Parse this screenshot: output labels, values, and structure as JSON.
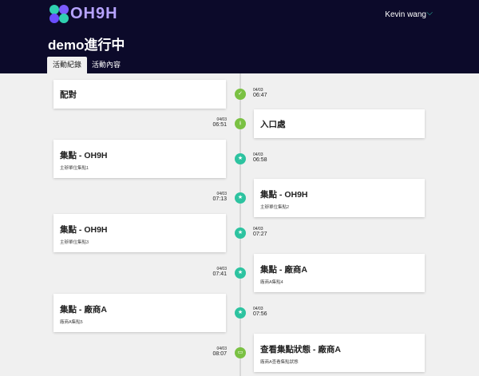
{
  "app": {
    "brand": "OH9H",
    "colors": {
      "header_bg": "#0c0a2a",
      "accent_green": "#7ac143",
      "accent_teal": "#2dc3a0",
      "brand_purple": "#b6a3ff"
    }
  },
  "header": {
    "user_name": "Kevin wang",
    "page_title": "demo進行中",
    "tabs": [
      {
        "label": "活動紀錄",
        "active": true
      },
      {
        "label": "活動內容",
        "active": false
      }
    ]
  },
  "timeline": [
    {
      "side": "left",
      "title": "配對",
      "subtitle": "",
      "date": "04/03",
      "time": "06:47",
      "icon": "check-icon",
      "color": "#7ac143"
    },
    {
      "side": "right",
      "title": "入口處",
      "subtitle": "",
      "date": "04/03",
      "time": "06:51",
      "icon": "download-icon",
      "color": "#7ac143"
    },
    {
      "side": "left",
      "title": "集點 - OH9H",
      "subtitle": "主辦單位集點1",
      "date": "04/03",
      "time": "06:58",
      "icon": "star-icon",
      "color": "#2dc3a0"
    },
    {
      "side": "right",
      "title": "集點 - OH9H",
      "subtitle": "主辦單位集點2",
      "date": "04/03",
      "time": "07:13",
      "icon": "star-icon",
      "color": "#2dc3a0"
    },
    {
      "side": "left",
      "title": "集點 - OH9H",
      "subtitle": "主辦單位集點3",
      "date": "04/03",
      "time": "07:27",
      "icon": "star-icon",
      "color": "#2dc3a0"
    },
    {
      "side": "right",
      "title": "集點 - 廠商A",
      "subtitle": "廠商A集點4",
      "date": "04/03",
      "time": "07:41",
      "icon": "star-icon",
      "color": "#2dc3a0"
    },
    {
      "side": "left",
      "title": "集點 - 廠商A",
      "subtitle": "廠商A集點5",
      "date": "04/03",
      "time": "07:56",
      "icon": "star-icon",
      "color": "#2dc3a0"
    },
    {
      "side": "right",
      "title": "查看集點狀態 - 廠商A",
      "subtitle": "廠商A查看集點狀態",
      "date": "04/03",
      "time": "08:07",
      "icon": "monitor-icon",
      "color": "#7ac143"
    }
  ]
}
